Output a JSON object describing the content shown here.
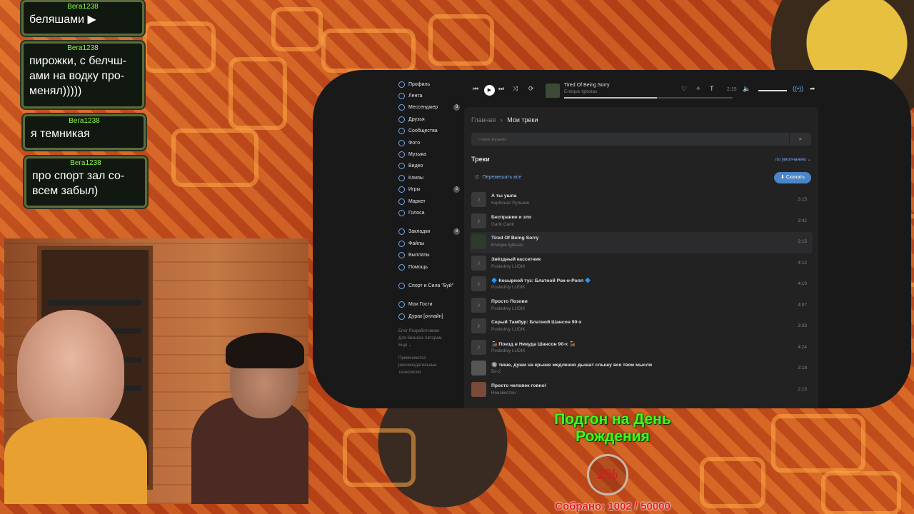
{
  "chat": [
    {
      "nick": "Вега1238",
      "text": "беляшами ▶"
    },
    {
      "nick": "Вега1238",
      "text": "пирожки, с белчш-ами на водку про-менял)))))"
    },
    {
      "nick": "Вега1238",
      "text": "я темникая"
    },
    {
      "nick": "Вега1238",
      "text": "про спорт зал со-всем забыл)"
    }
  ],
  "sidebar": {
    "items": [
      {
        "label": "Профиль",
        "badge": ""
      },
      {
        "label": "Лента",
        "badge": ""
      },
      {
        "label": "Мессенджер",
        "badge": "3"
      },
      {
        "label": "Друзья",
        "badge": ""
      },
      {
        "label": "Сообщества",
        "badge": ""
      },
      {
        "label": "Фото",
        "badge": ""
      },
      {
        "label": "Музыка",
        "badge": ""
      },
      {
        "label": "Видео",
        "badge": ""
      },
      {
        "label": "Клипы",
        "badge": ""
      },
      {
        "label": "Игры",
        "badge": "2"
      },
      {
        "label": "Маркет",
        "badge": ""
      },
      {
        "label": "Голоса",
        "badge": ""
      }
    ],
    "items2": [
      {
        "label": "Закладки",
        "badge": "3"
      },
      {
        "label": "Файлы",
        "badge": ""
      },
      {
        "label": "Выплаты",
        "badge": ""
      },
      {
        "label": "Помощь",
        "badge": ""
      }
    ],
    "items3": [
      {
        "label": "Спорт и Сила \"Буй\""
      }
    ],
    "items4": [
      {
        "label": "Мои Гости"
      },
      {
        "label": "Дурак [онлайн]"
      }
    ],
    "footer1": "Блог  Разработчикам",
    "footer2": "Для бизнеса  Авторам",
    "footer3": "Ещё ⌄",
    "footer4": "Применяются рекомендательные технологии"
  },
  "player": {
    "title": "Tired Of Being Sorry",
    "artist": "Enrique Iglesias",
    "time": "2:15",
    "progress": 0.55
  },
  "breadcrumb": {
    "home": "Главная",
    "sep": "›",
    "current": "Мои треки"
  },
  "search": {
    "placeholder": "Поиск музыки"
  },
  "tracks_header": "Треки",
  "sort_label": "по умолчанию ⌄",
  "shuffle_label": "Перемешать все",
  "download_label": "Скачать",
  "tracks": [
    {
      "title": "А ты ушла",
      "artist": "Карбонат Рулькин",
      "duration": "3:15"
    },
    {
      "title": "Бесправие и зло",
      "artist": "Garik Garik",
      "duration": "3:42"
    },
    {
      "title": "Tired Of Being Sorry",
      "artist": "Enrique Iglesias",
      "duration": "2:15"
    },
    {
      "title": "Звёздный кассетник",
      "artist": "Posledniy LUDIK",
      "duration": "4:12"
    },
    {
      "title": "🔷 Козырной туз: Блатной Рок-н-Ролл 🔷",
      "artist": "Posledniy LUDIK",
      "duration": "4:10"
    },
    {
      "title": "Просто Позови",
      "artist": "Posledniy LUDIK",
      "duration": "4:07"
    },
    {
      "title": "Серый Тамбур: Блатной Шансон 90-х",
      "artist": "Posledniy LUDIK",
      "duration": "3:33"
    },
    {
      "title": "🚂 Поезд в Никуда Шансон 90-х 🚂",
      "artist": "Posledniy LUDIK",
      "duration": "4:24"
    },
    {
      "title": "🔘 тише, души на крыше медленно дышат слышу все твои мысли",
      "artist": "Би-2",
      "duration": "3:18"
    },
    {
      "title": "Просто человек говно!",
      "artist": "Неизвестен",
      "duration": "2:13"
    }
  ],
  "donation": {
    "title": "Подгон на День Рождения",
    "percent": "2%",
    "collected": "Собрано: 1002 / 50000"
  }
}
